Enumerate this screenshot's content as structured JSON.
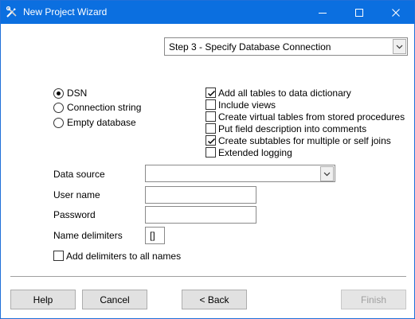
{
  "window": {
    "title": "New Project Wizard",
    "icons": {
      "app": "tools-icon",
      "minimize": "minimize-icon",
      "maximize": "maximize-icon",
      "close": "close-icon"
    },
    "titlebar_color": "#0b6fe0"
  },
  "step_select": {
    "value": "Step 3 - Specify Database Connection"
  },
  "source_options": [
    {
      "label": "DSN",
      "selected": true
    },
    {
      "label": "Connection string",
      "selected": false
    },
    {
      "label": "Empty database",
      "selected": false
    }
  ],
  "options": [
    {
      "label": "Add all tables to data dictionary",
      "checked": true
    },
    {
      "label": "Include views",
      "checked": false
    },
    {
      "label": "Create virtual tables from stored procedures",
      "checked": false
    },
    {
      "label": "Put field description into comments",
      "checked": false
    },
    {
      "label": "Create subtables for multiple or self joins",
      "checked": true
    },
    {
      "label": "Extended logging",
      "checked": false
    }
  ],
  "form": {
    "data_source": {
      "label": "Data source",
      "value": ""
    },
    "user_name": {
      "label": "User name",
      "value": ""
    },
    "password": {
      "label": "Password",
      "value": ""
    },
    "name_delimiters": {
      "label": "Name delimiters",
      "value": "[]"
    },
    "add_delimiters": {
      "label": "Add delimiters to all names",
      "checked": false
    }
  },
  "buttons": {
    "help": "Help",
    "cancel": "Cancel",
    "back": "< Back",
    "finish": "Finish"
  }
}
